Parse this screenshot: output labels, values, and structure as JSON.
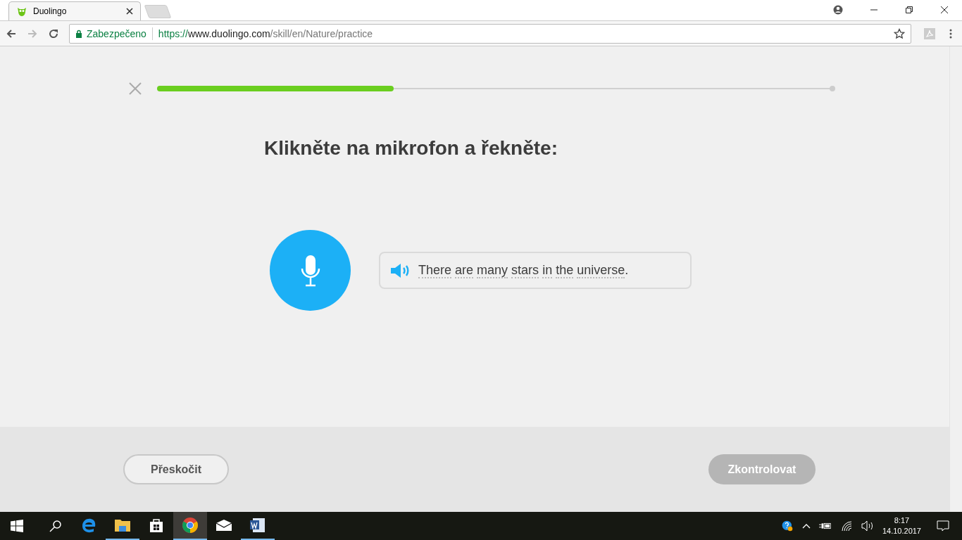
{
  "browser": {
    "tab_title": "Duolingo",
    "security_label": "Zabezpečeno",
    "url": {
      "scheme": "https://",
      "host": "www.duolingo.com",
      "path": "/skill/en/Nature/practice"
    }
  },
  "lesson": {
    "progress": {
      "level": 0.35
    },
    "instruction": "Klikněte na mikrofon a řekněte:",
    "sentence_words": [
      "There",
      "are",
      "many",
      "stars",
      "in",
      "the",
      "universe"
    ],
    "sentence_end": ".",
    "skip_button": "Přeskočit",
    "check_button": {
      "label": "Zkontrolovat",
      "disabled": true
    }
  },
  "taskbar": {
    "apps": [
      {
        "kind": "edge",
        "running": false,
        "selected": false
      },
      {
        "kind": "files",
        "running": true,
        "selected": false
      },
      {
        "kind": "store",
        "running": false,
        "selected": false
      },
      {
        "kind": "chrome",
        "running": true,
        "selected": true
      },
      {
        "kind": "mail",
        "running": false,
        "selected": false
      },
      {
        "kind": "word",
        "running": true,
        "selected": false
      }
    ],
    "time": "8:17",
    "date": "14.10.2017"
  }
}
